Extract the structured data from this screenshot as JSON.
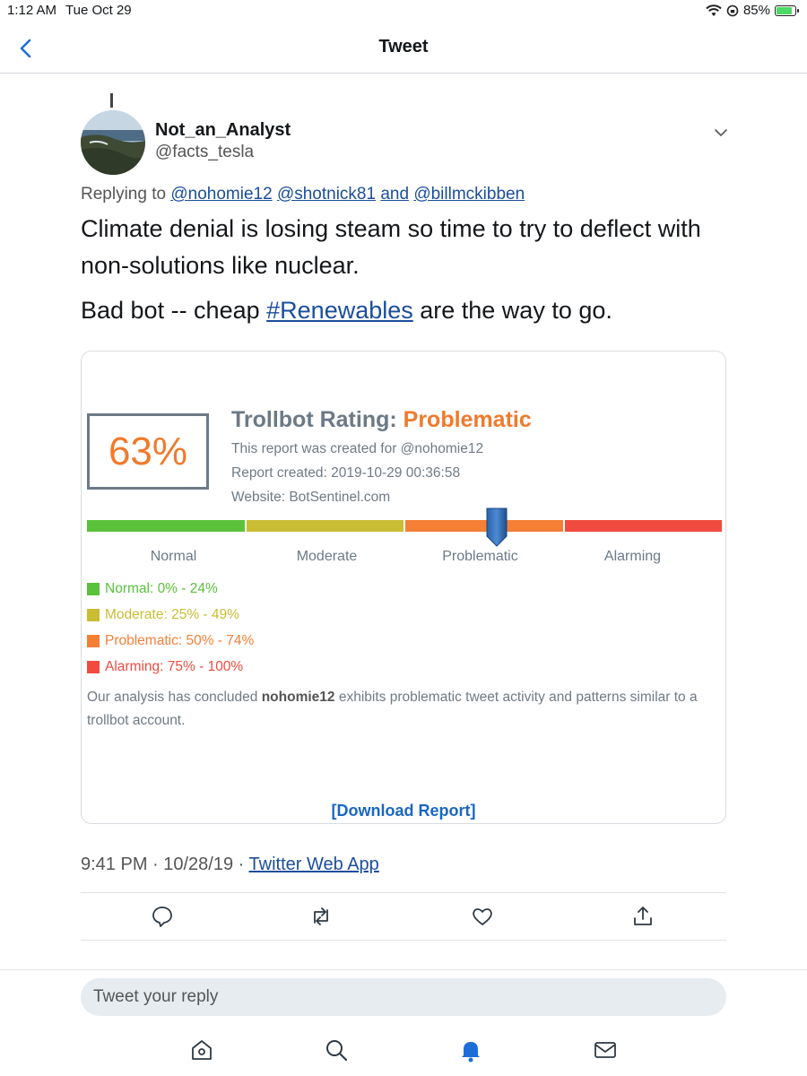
{
  "status_bar": {
    "time": "1:12 AM",
    "date": "Tue Oct 29",
    "battery": "85%"
  },
  "nav": {
    "title": "Tweet"
  },
  "tweet": {
    "display_name": "Not_an_Analyst",
    "handle": "@facts_tesla",
    "replying_prefix": "Replying to",
    "replying_user1": "@nohomie12",
    "replying_user2": "@shotnick81",
    "replying_and": "and",
    "replying_user3": "@billmckibben",
    "text_line1": "Climate denial is losing steam so time to try to deflect with non-solutions like nuclear.",
    "text2_prefix": "Bad bot -- cheap ",
    "text2_hashtag": "#Renewables",
    "text2_suffix": " are the way to go.",
    "timestamp": "9:41 PM · 10/28/19 · ",
    "source": "Twitter Web App"
  },
  "card": {
    "score": "63%",
    "rating_label": "Trollbot Rating:",
    "rating_value": "Problematic",
    "report_for": "This report was created for @nohomie12",
    "report_created": "Report created: 2019-10-29 00:36:58",
    "website": "Website: BotSentinel.com",
    "scale": {
      "labels": [
        "Normal",
        "Moderate",
        "Problematic",
        "Alarming"
      ],
      "colors": [
        "#5ac13b",
        "#c9bd34",
        "#f47f35",
        "#f04b3e"
      ],
      "pointer_category": "Problematic"
    },
    "legend": [
      {
        "text": "Normal: 0% - 24%",
        "color": "#5ac13b"
      },
      {
        "text": "Moderate: 25% - 49%",
        "color": "#c9bd34"
      },
      {
        "text": "Problematic: 50% - 74%",
        "color": "#f47f35"
      },
      {
        "text": "Alarming: 75% - 100%",
        "color": "#f04b3e"
      }
    ],
    "analysis_prefix": "Our analysis has concluded ",
    "analysis_user": "nohomie12",
    "analysis_suffix": " exhibits problematic tweet activity and patterns similar to a trollbot account.",
    "download": "[Download Report]"
  },
  "reply": {
    "placeholder": "Tweet your reply"
  },
  "actions": [
    "reply-icon",
    "retweet-icon",
    "like-icon",
    "share-icon"
  ],
  "tabs": [
    "home-icon",
    "search-icon",
    "notifications-icon",
    "messages-icon"
  ],
  "colors": {
    "link": "#1b4e9b",
    "accent": "#1da1f2",
    "orange": "#f07a2c"
  }
}
